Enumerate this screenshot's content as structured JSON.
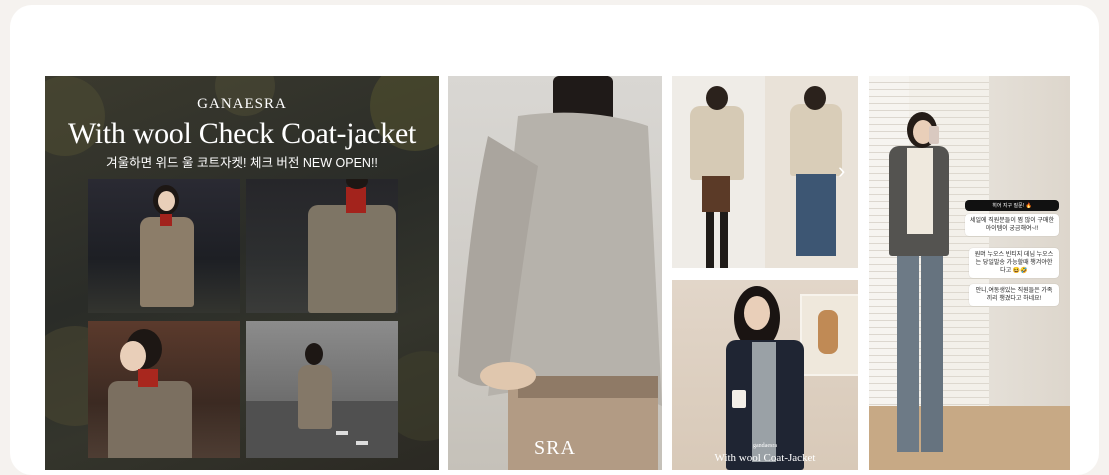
{
  "gallery": {
    "tiles": [
      {
        "id": "t1",
        "brand": "GANAESRA",
        "headline": "With wool Check Coat-jacket",
        "subline": "겨울하면 위드 울 코트자켓! 체크 버전 NEW OPEN!!"
      },
      {
        "id": "t2",
        "logo": "SRA"
      },
      {
        "id": "t3",
        "next_arrow": "›"
      },
      {
        "id": "t4",
        "caption_small": "gandaesra",
        "caption": "With wool Coat-Jacket"
      },
      {
        "id": "t5",
        "story_header": "히어 지구 질문! 🔥",
        "story_question": "세일에 직원분들이 찜 많이 구매한 아이템이 궁금해여~!!",
        "story_answer_1": "원머 누오스 빈티지 데님 누오스는 당일발송 가능할때 챙겨야한다고 😆🤣",
        "story_answer_2": "안니,여동생있는 직원들은 가족끼리 챙겼다고 하네요!"
      }
    ]
  }
}
